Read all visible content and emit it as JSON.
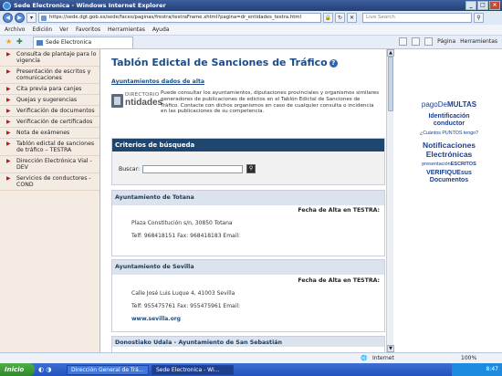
{
  "window": {
    "title": "Sede Electronica - Windows Internet Explorer",
    "buttons": [
      "_",
      "□",
      "×"
    ]
  },
  "address": {
    "url": "https://sede.dgt.gob.es/sede/faces/paginas/frestra/testraFrame.xhtml?pagina=dr_entidades_testra.html",
    "search_placeholder": "Live Search"
  },
  "menu": [
    "Archivo",
    "Edición",
    "Ver",
    "Favoritos",
    "Herramientas",
    "Ayuda"
  ],
  "tab": {
    "label": "Sede Electronica"
  },
  "tools": {
    "page": "Página",
    "tools": "Herramientas"
  },
  "sidebar": {
    "items": [
      {
        "label": "Consulta de plantaje para lo vigencia"
      },
      {
        "label": "Presentación de escritos y comunicaciones"
      },
      {
        "label": "Cita previa para canjes"
      },
      {
        "label": "Quejas y sugerencias"
      },
      {
        "label": "Verificación de documentos"
      },
      {
        "label": "Verificación de certificados"
      },
      {
        "label": "Nota de exámenes"
      },
      {
        "label": "Tablón edictal de sanciones de tráfico – TESTRA"
      },
      {
        "label": "Dirección Electrónica Vial - DEV"
      },
      {
        "label": "Servicios de conductores - COND"
      }
    ]
  },
  "main": {
    "title": "Tablón Edictal de Sanciones de Tráfico",
    "help_icon": "?",
    "subtitle": "Ayuntamientos dados de alta",
    "logo": {
      "top": "DIRECTORIO",
      "bottom": "ntidades"
    },
    "intro": "Puede consultar los ayuntamientos, diputaciones provinciales y organismos similares generadores de publicaciones de edictos en el Tablón Edictal de Sanciones de Tráfico. Contacte con dichos organismos en caso de cualquier consulta o incidencia en las publicaciones de su competencia.",
    "search": {
      "header": "Criterios de búsqueda",
      "label": "Buscar:",
      "value": ""
    },
    "cards": [
      {
        "name": "Ayuntamiento de Totana",
        "fecha": "Fecha de Alta en TESTRA:",
        "address": "Plaza Constitución s/n, 30850 Totana",
        "phones": "Telf: 968418151 Fax: 968418183 Email:",
        "web": ""
      },
      {
        "name": "Ayuntamiento de Sevilla",
        "fecha": "Fecha de Alta en TESTRA:",
        "address": "Calle José Luis Luque 4, 41003 Sevilla",
        "phones": "Telf: 955475761 Fax: 955475961 Email:",
        "web": "www.sevilla.org"
      },
      {
        "name": "Donostiako Udala - Ayuntamiento de San Sebastián",
        "fecha": "",
        "address": "",
        "phones": "",
        "web": ""
      }
    ]
  },
  "right": {
    "pago_prefix": "pagoDe",
    "pago_suffix": "MULTAS",
    "identificacion": "Identificación conductor",
    "puntos": "¿Cuántos PUNTOS tengo?",
    "notificaciones": "Notificaciones Electrónicas",
    "escritos_prefix": "presentación",
    "escritos_suffix": "ESCRITOS",
    "verifique": "VERIFIQUEsus Documentos"
  },
  "status": {
    "zone": "Internet",
    "zoom": "100%"
  },
  "taskbar": {
    "start": "Inicio",
    "buttons": [
      "Dirección General de Trá...",
      "Sede Electronica - Wi..."
    ],
    "clock": "8:47"
  }
}
